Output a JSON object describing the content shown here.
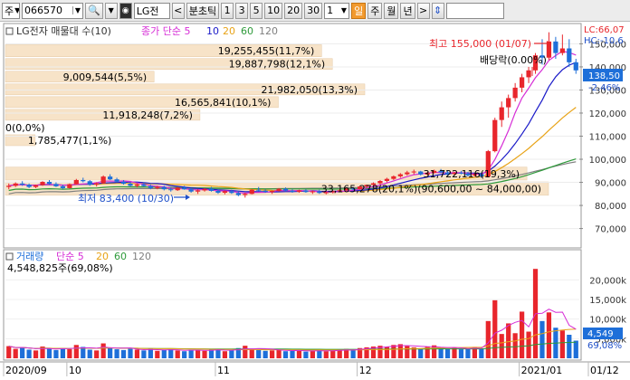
{
  "toolbar": {
    "market": "주",
    "code": "066570",
    "stock_name": "LG전",
    "period_label": "분초틱",
    "period_buttons": [
      "1",
      "3",
      "5",
      "10",
      "20",
      "30"
    ],
    "unit_value": "1",
    "active_period": "일",
    "other_periods": [
      "주",
      "월",
      "년"
    ],
    "next_arrow": ">",
    "updown_arrow": "⇕"
  },
  "price_panel": {
    "legend": {
      "title": "LG전자 매물대 수(10)",
      "ma_label": "종가 단순 5",
      "ma_periods": [
        "10",
        "20",
        "60",
        "120"
      ]
    },
    "lc_label": "LC:66,07",
    "hc_label": "HC:-10,6",
    "high_label": "최고 155,000 (01/07)",
    "low_label": "최저 83,400 (10/30)",
    "dividend_label": "배당락(0.00%)",
    "current_price": "138,50",
    "current_change": "-2.46%",
    "y_ticks": [
      "150,000",
      "140,000",
      "130,000",
      "120,000",
      "110,000",
      "100,000",
      "90,000",
      "80,000",
      "70,000"
    ],
    "volume_profile": [
      "19,255,455(11,7%)",
      "19,887,798(12,1%)",
      "9,009,544(5,5%)",
      "21,982,050(13,3%)",
      "16,565,841(10,1%)",
      "11,918,248(7,2%)",
      "0(0,0%)",
      "1,785,477(1,1%)",
      "33,165,278(20,1%)(90,600,00 ~ 84,000,00)",
      "31,722,116(19,3%)"
    ]
  },
  "volume_panel": {
    "legend": {
      "title": "거래량",
      "ma_label": "단순 5",
      "ma_periods": [
        "20",
        "60",
        "120"
      ]
    },
    "volume_profile_label": "4,548,825주(69,08%)",
    "current_volume": "4,549",
    "current_pct": "69,08%",
    "y_ticks": [
      "20,000k",
      "15,000k",
      "10,000k",
      "5,000k"
    ]
  },
  "x_axis": [
    "2020/09",
    "10",
    "11",
    "12",
    "2021/01",
    "01/12"
  ],
  "colors": {
    "up": "#E8262C",
    "down": "#1E6FD9",
    "profile": "#F7E3C8",
    "ma5": "#D62DD6",
    "ma10": "#1A1AC8",
    "ma20": "#E8A317",
    "ma60": "#2E9A3A",
    "ma120": "#7F7F7F"
  },
  "chart_data": {
    "type": "candlestick",
    "y_range": [
      62000,
      158000
    ],
    "candles": [
      [
        88000,
        89500,
        87000,
        88500
      ],
      [
        88500,
        90000,
        88000,
        89500
      ],
      [
        89500,
        90500,
        88500,
        89000
      ],
      [
        89000,
        89500,
        87500,
        88000
      ],
      [
        88000,
        89000,
        87500,
        88800
      ],
      [
        88800,
        90500,
        88500,
        90200
      ],
      [
        90200,
        91000,
        89000,
        89300
      ],
      [
        89300,
        90000,
        88000,
        88300
      ],
      [
        88300,
        89000,
        87000,
        87500
      ],
      [
        87500,
        89500,
        87300,
        89200
      ],
      [
        89200,
        91500,
        89000,
        91000
      ],
      [
        91000,
        92000,
        90000,
        90500
      ],
      [
        90500,
        91000,
        88500,
        89000
      ],
      [
        89000,
        90000,
        88200,
        89600
      ],
      [
        89600,
        93000,
        89400,
        92500
      ],
      [
        92500,
        93500,
        91000,
        91300
      ],
      [
        91300,
        92000,
        90000,
        90300
      ],
      [
        90300,
        91000,
        89000,
        89400
      ],
      [
        89400,
        90000,
        88000,
        88500
      ],
      [
        88500,
        89500,
        87800,
        89100
      ],
      [
        89100,
        90000,
        88000,
        88400
      ],
      [
        88400,
        89000,
        87000,
        87500
      ],
      [
        87500,
        88500,
        87000,
        88000
      ],
      [
        88000,
        88500,
        86500,
        87000
      ],
      [
        87000,
        87800,
        86000,
        86600
      ],
      [
        86600,
        88000,
        86300,
        87700
      ],
      [
        87700,
        88500,
        86800,
        87000
      ],
      [
        87000,
        87500,
        85500,
        86000
      ],
      [
        86000,
        87000,
        85000,
        86500
      ],
      [
        86500,
        87500,
        86000,
        87200
      ],
      [
        87200,
        88000,
        86000,
        86300
      ],
      [
        86300,
        87000,
        85000,
        85500
      ],
      [
        85500,
        86500,
        84800,
        86200
      ],
      [
        86200,
        86800,
        85000,
        85400
      ],
      [
        85400,
        86000,
        84000,
        84500
      ],
      [
        84500,
        85500,
        83400,
        85000
      ],
      [
        85000,
        87000,
        84800,
        86800
      ],
      [
        86800,
        88000,
        86000,
        86400
      ],
      [
        86400,
        87000,
        85500,
        85800
      ],
      [
        85800,
        86500,
        85000,
        86300
      ],
      [
        86300,
        87500,
        86000,
        87200
      ],
      [
        87200,
        87800,
        86000,
        86400
      ],
      [
        86400,
        87000,
        85500,
        85900
      ],
      [
        85900,
        86800,
        85500,
        86500
      ],
      [
        86500,
        87000,
        85500,
        85800
      ],
      [
        85800,
        86500,
        85000,
        86100
      ],
      [
        86100,
        86800,
        85000,
        85400
      ],
      [
        85400,
        86000,
        84800,
        85700
      ],
      [
        85700,
        86500,
        85200,
        86200
      ],
      [
        86200,
        87000,
        85800,
        86600
      ],
      [
        86600,
        87500,
        86200,
        87300
      ],
      [
        87300,
        88000,
        86600,
        87000
      ],
      [
        87000,
        88500,
        86800,
        88200
      ],
      [
        88200,
        89000,
        87500,
        88900
      ],
      [
        88900,
        90000,
        88500,
        89600
      ],
      [
        89600,
        91000,
        89000,
        90600
      ],
      [
        90600,
        92000,
        90000,
        91500
      ],
      [
        91500,
        93000,
        91000,
        92600
      ],
      [
        92600,
        94000,
        92000,
        93500
      ],
      [
        93500,
        95000,
        93000,
        94300
      ],
      [
        94300,
        95500,
        93500,
        94700
      ],
      [
        94700,
        95000,
        93000,
        93400
      ],
      [
        93400,
        94500,
        93000,
        94100
      ],
      [
        94100,
        95500,
        93800,
        95000
      ],
      [
        95000,
        95800,
        94000,
        94300
      ],
      [
        94300,
        95000,
        93000,
        93600
      ],
      [
        93600,
        94500,
        93200,
        94200
      ],
      [
        94200,
        95000,
        93500,
        93800
      ],
      [
        93800,
        94500,
        92500,
        93000
      ],
      [
        93000,
        94000,
        92500,
        93600
      ],
      [
        93600,
        94200,
        92000,
        92500
      ],
      [
        92500,
        104000,
        92300,
        103500
      ],
      [
        103500,
        118000,
        103000,
        117000
      ],
      [
        117000,
        125000,
        114000,
        122500
      ],
      [
        122500,
        128000,
        118000,
        126500
      ],
      [
        126500,
        133000,
        125000,
        131000
      ],
      [
        131000,
        137000,
        129000,
        135500
      ],
      [
        135500,
        140000,
        133000,
        138500
      ],
      [
        138500,
        146000,
        137000,
        145000
      ],
      [
        145000,
        152000,
        141000,
        144000
      ],
      [
        144000,
        155000,
        143000,
        151000
      ],
      [
        151000,
        153000,
        143500,
        146000
      ],
      [
        146000,
        154000,
        145000,
        148000
      ],
      [
        148000,
        152000,
        140000,
        142000
      ],
      [
        142000,
        143500,
        137000,
        138500
      ]
    ],
    "volumes": [
      3.1,
      2.4,
      2.8,
      2.2,
      2.0,
      3.0,
      2.5,
      2.1,
      2.6,
      2.3,
      3.4,
      2.9,
      2.2,
      2.0,
      3.8,
      2.7,
      2.3,
      2.1,
      2.4,
      2.2,
      2.0,
      2.5,
      1.9,
      2.1,
      2.3,
      2.0,
      1.8,
      2.2,
      2.1,
      1.9,
      2.2,
      2.4,
      1.8,
      2.0,
      2.6,
      3.2,
      2.4,
      2.1,
      1.9,
      2.0,
      2.2,
      1.8,
      1.9,
      2.0,
      1.7,
      1.9,
      2.1,
      1.8,
      2.0,
      2.2,
      2.4,
      2.1,
      2.6,
      2.8,
      3.0,
      3.2,
      2.9,
      3.4,
      3.6,
      3.1,
      2.8,
      2.5,
      2.9,
      3.3,
      2.6,
      2.4,
      2.7,
      2.3,
      2.5,
      2.9,
      2.4,
      9.5,
      14.8,
      6.2,
      8.9,
      6.4,
      11.9,
      6.8,
      22.8,
      9.5,
      11.7,
      7.8,
      7.1,
      6.0,
      4.5
    ],
    "profile_bins": [
      {
        "low": 144000,
        "high": 150000,
        "pct": 11.7
      },
      {
        "low": 138500,
        "high": 144000,
        "pct": 12.1
      },
      {
        "low": 133000,
        "high": 138500,
        "pct": 5.5
      },
      {
        "low": 127500,
        "high": 133000,
        "pct": 13.3
      },
      {
        "low": 122000,
        "high": 127500,
        "pct": 10.1
      },
      {
        "low": 116500,
        "high": 122000,
        "pct": 7.2
      },
      {
        "low": 111000,
        "high": 116500,
        "pct": 0.0
      },
      {
        "low": 105500,
        "high": 111000,
        "pct": 1.1
      },
      {
        "low": 84000,
        "high": 90600,
        "pct": 20.1
      },
      {
        "low": 90600,
        "high": 97000,
        "pct": 19.3
      }
    ],
    "volume_y_range": [
      0,
      24
    ],
    "candle_count": 85
  }
}
